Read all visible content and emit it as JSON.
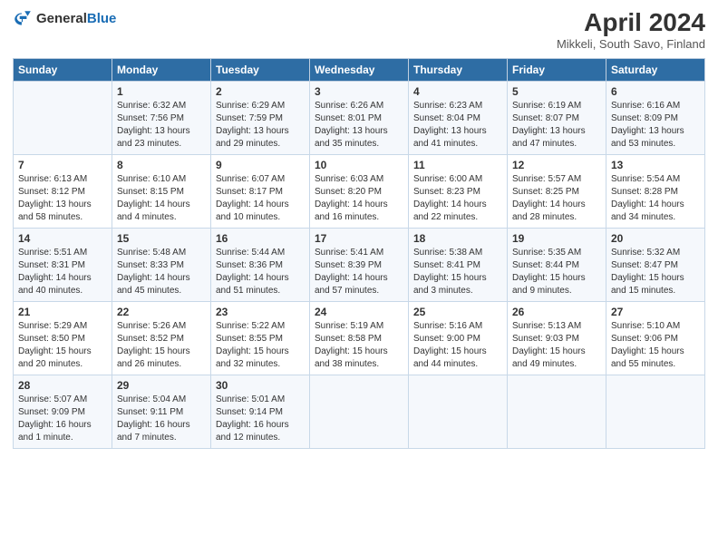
{
  "header": {
    "logo_general": "General",
    "logo_blue": "Blue",
    "title": "April 2024",
    "subtitle": "Mikkeli, South Savo, Finland"
  },
  "columns": [
    "Sunday",
    "Monday",
    "Tuesday",
    "Wednesday",
    "Thursday",
    "Friday",
    "Saturday"
  ],
  "weeks": [
    [
      {
        "day": "",
        "info": ""
      },
      {
        "day": "1",
        "info": "Sunrise: 6:32 AM\nSunset: 7:56 PM\nDaylight: 13 hours\nand 23 minutes."
      },
      {
        "day": "2",
        "info": "Sunrise: 6:29 AM\nSunset: 7:59 PM\nDaylight: 13 hours\nand 29 minutes."
      },
      {
        "day": "3",
        "info": "Sunrise: 6:26 AM\nSunset: 8:01 PM\nDaylight: 13 hours\nand 35 minutes."
      },
      {
        "day": "4",
        "info": "Sunrise: 6:23 AM\nSunset: 8:04 PM\nDaylight: 13 hours\nand 41 minutes."
      },
      {
        "day": "5",
        "info": "Sunrise: 6:19 AM\nSunset: 8:07 PM\nDaylight: 13 hours\nand 47 minutes."
      },
      {
        "day": "6",
        "info": "Sunrise: 6:16 AM\nSunset: 8:09 PM\nDaylight: 13 hours\nand 53 minutes."
      }
    ],
    [
      {
        "day": "7",
        "info": "Sunrise: 6:13 AM\nSunset: 8:12 PM\nDaylight: 13 hours\nand 58 minutes."
      },
      {
        "day": "8",
        "info": "Sunrise: 6:10 AM\nSunset: 8:15 PM\nDaylight: 14 hours\nand 4 minutes."
      },
      {
        "day": "9",
        "info": "Sunrise: 6:07 AM\nSunset: 8:17 PM\nDaylight: 14 hours\nand 10 minutes."
      },
      {
        "day": "10",
        "info": "Sunrise: 6:03 AM\nSunset: 8:20 PM\nDaylight: 14 hours\nand 16 minutes."
      },
      {
        "day": "11",
        "info": "Sunrise: 6:00 AM\nSunset: 8:23 PM\nDaylight: 14 hours\nand 22 minutes."
      },
      {
        "day": "12",
        "info": "Sunrise: 5:57 AM\nSunset: 8:25 PM\nDaylight: 14 hours\nand 28 minutes."
      },
      {
        "day": "13",
        "info": "Sunrise: 5:54 AM\nSunset: 8:28 PM\nDaylight: 14 hours\nand 34 minutes."
      }
    ],
    [
      {
        "day": "14",
        "info": "Sunrise: 5:51 AM\nSunset: 8:31 PM\nDaylight: 14 hours\nand 40 minutes."
      },
      {
        "day": "15",
        "info": "Sunrise: 5:48 AM\nSunset: 8:33 PM\nDaylight: 14 hours\nand 45 minutes."
      },
      {
        "day": "16",
        "info": "Sunrise: 5:44 AM\nSunset: 8:36 PM\nDaylight: 14 hours\nand 51 minutes."
      },
      {
        "day": "17",
        "info": "Sunrise: 5:41 AM\nSunset: 8:39 PM\nDaylight: 14 hours\nand 57 minutes."
      },
      {
        "day": "18",
        "info": "Sunrise: 5:38 AM\nSunset: 8:41 PM\nDaylight: 15 hours\nand 3 minutes."
      },
      {
        "day": "19",
        "info": "Sunrise: 5:35 AM\nSunset: 8:44 PM\nDaylight: 15 hours\nand 9 minutes."
      },
      {
        "day": "20",
        "info": "Sunrise: 5:32 AM\nSunset: 8:47 PM\nDaylight: 15 hours\nand 15 minutes."
      }
    ],
    [
      {
        "day": "21",
        "info": "Sunrise: 5:29 AM\nSunset: 8:50 PM\nDaylight: 15 hours\nand 20 minutes."
      },
      {
        "day": "22",
        "info": "Sunrise: 5:26 AM\nSunset: 8:52 PM\nDaylight: 15 hours\nand 26 minutes."
      },
      {
        "day": "23",
        "info": "Sunrise: 5:22 AM\nSunset: 8:55 PM\nDaylight: 15 hours\nand 32 minutes."
      },
      {
        "day": "24",
        "info": "Sunrise: 5:19 AM\nSunset: 8:58 PM\nDaylight: 15 hours\nand 38 minutes."
      },
      {
        "day": "25",
        "info": "Sunrise: 5:16 AM\nSunset: 9:00 PM\nDaylight: 15 hours\nand 44 minutes."
      },
      {
        "day": "26",
        "info": "Sunrise: 5:13 AM\nSunset: 9:03 PM\nDaylight: 15 hours\nand 49 minutes."
      },
      {
        "day": "27",
        "info": "Sunrise: 5:10 AM\nSunset: 9:06 PM\nDaylight: 15 hours\nand 55 minutes."
      }
    ],
    [
      {
        "day": "28",
        "info": "Sunrise: 5:07 AM\nSunset: 9:09 PM\nDaylight: 16 hours\nand 1 minute."
      },
      {
        "day": "29",
        "info": "Sunrise: 5:04 AM\nSunset: 9:11 PM\nDaylight: 16 hours\nand 7 minutes."
      },
      {
        "day": "30",
        "info": "Sunrise: 5:01 AM\nSunset: 9:14 PM\nDaylight: 16 hours\nand 12 minutes."
      },
      {
        "day": "",
        "info": ""
      },
      {
        "day": "",
        "info": ""
      },
      {
        "day": "",
        "info": ""
      },
      {
        "day": "",
        "info": ""
      }
    ]
  ]
}
